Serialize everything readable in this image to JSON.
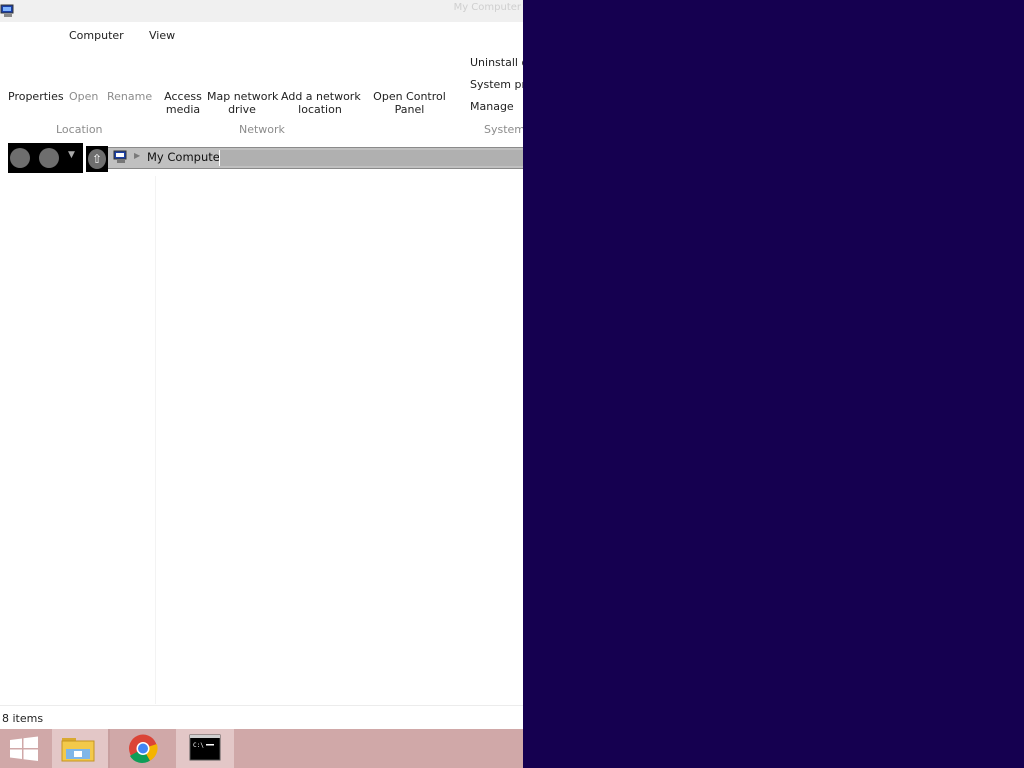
{
  "window": {
    "title": "My Computer",
    "icon": "computer-icon"
  },
  "ribbon": {
    "tabs": [
      {
        "label": "Computer"
      },
      {
        "label": "View"
      }
    ],
    "location": {
      "group_label": "Location",
      "properties": "Properties",
      "open": "Open",
      "rename": "Rename"
    },
    "network": {
      "group_label": "Network",
      "access_media_1": "Access",
      "access_media_2": "media",
      "map_drive_1": "Map network",
      "map_drive_2": "drive",
      "add_location_1": "Add a network",
      "add_location_2": "location"
    },
    "system": {
      "group_label": "System",
      "open_control_panel_1": "Open Control",
      "open_control_panel_2": "Panel",
      "uninstall": "Uninstall o",
      "system_properties": "System pro",
      "manage": "Manage"
    }
  },
  "address_bar": {
    "icon": "computer-icon",
    "path": "My Computer"
  },
  "statusbar": {
    "item_count": "8 items"
  },
  "taskbar": {
    "items": [
      {
        "name": "start",
        "icon": "windows-logo-icon"
      },
      {
        "name": "file-explorer",
        "icon": "folder-icon"
      },
      {
        "name": "chrome",
        "icon": "chrome-icon"
      },
      {
        "name": "command-prompt",
        "icon": "cmd-icon"
      }
    ]
  },
  "colors": {
    "desktop_background": "#150050",
    "taskbar": "#d0a8a8",
    "disabled_text": "#8c8c8c"
  }
}
